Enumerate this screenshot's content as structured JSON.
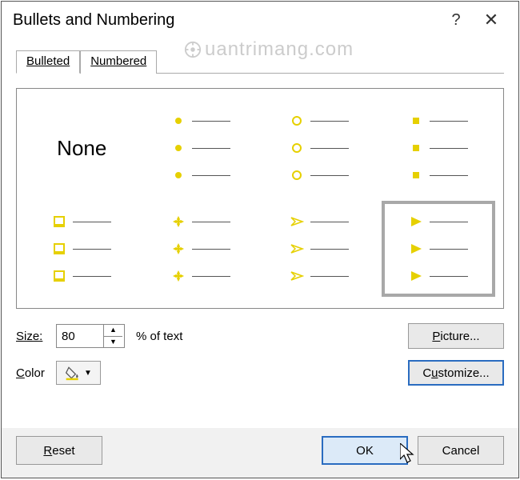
{
  "window": {
    "title": "Bullets and Numbering",
    "help": "?",
    "close": "✕"
  },
  "tabs": {
    "bulleted": "Bulleted",
    "numbered": "Numbered"
  },
  "none_label": "None",
  "controls": {
    "size_label": "Size:",
    "size_value": "80",
    "pct_label": "% of text",
    "color_label": "Color",
    "picture_btn": "Picture...",
    "customize_btn": "Customize..."
  },
  "footer": {
    "reset": "Reset",
    "ok": "OK",
    "cancel": "Cancel"
  },
  "watermark": "uantrimang.com",
  "bullet_color": "#e6d000"
}
